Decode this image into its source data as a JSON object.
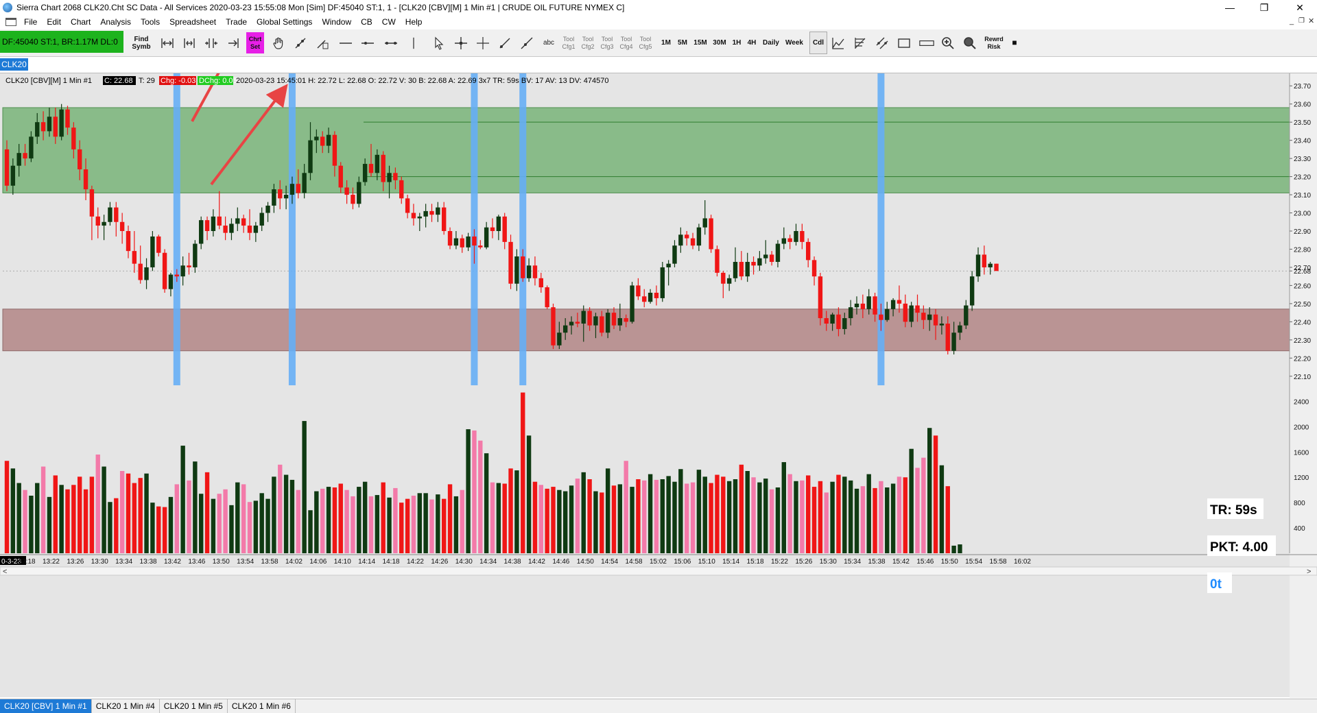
{
  "window": {
    "title": "Sierra Chart 2068 CLK20.Cht  SC Data - All Services 2020-03-23  15:55:08 Mon [Sim]  DF:45040  ST:1, 1 - [CLK20 [CBV][M]  1 Min  #1 | CRUDE OIL FUTURE NYMEX C]",
    "minimize": "—",
    "restore": "❐",
    "close": "✕"
  },
  "menu": [
    "File",
    "Edit",
    "Chart",
    "Analysis",
    "Tools",
    "Spreadsheet",
    "Trade",
    "Global Settings",
    "Window",
    "CB",
    "CW",
    "Help"
  ],
  "status_box": "DF:45040  ST:1,  BR:1.17M  DL:0",
  "toolbar": {
    "find_symbol": "Find Symb",
    "chart_settings": "Chrt Set",
    "text_tool": "abc",
    "tool_cfgs": [
      "Tool Cfg1",
      "Tool Cfg2",
      "Tool Cfg3",
      "Tool Cfg4",
      "Tool Cfg5"
    ],
    "timeframes": [
      "1M",
      "5M",
      "15M",
      "30M",
      "1H",
      "4H",
      "Daily",
      "Week"
    ],
    "candle": "Cdl",
    "reward_risk": "Rewrd Risk",
    "stop": "■"
  },
  "symbol_tab": "CLK20",
  "chart_header": {
    "symbol": "CLK20 [CBV][M]  1 Min  #1",
    "close": "C: 22.68",
    "trades": "T: 29",
    "change": "Chg: -0.03",
    "dchange": "DChg: 0.05",
    "details": "2020-03-23  15:45:01  H: 22.72  L: 22.68  O: 22.72  V: 30  B: 22.68  A: 22.69  3x7  TR: 59s  BV: 17  AV: 13  DV: 474570"
  },
  "overlay": {
    "tr": "TR: 59s",
    "pkt": "PKT: 4.00",
    "ot": "0t"
  },
  "colors": {
    "up": "#0f3a12",
    "down": "#f01616",
    "vol_up": "#0f3a12",
    "vol_down": "#f01616",
    "vol_down_light": "#f37aa9",
    "supply_zone": "#6fb06f",
    "demand_zone": "#b38686",
    "vline": "#66aef5",
    "arrow": "#e84444",
    "background": "#e5e5e5"
  },
  "chart_data": {
    "type": "candlestick",
    "price_axis_labels": [
      "23.70",
      "23.60",
      "23.50",
      "23.40",
      "23.30",
      "23.20",
      "23.10",
      "23.00",
      "22.90",
      "22.80",
      "22.70",
      "22.68",
      "22.60",
      "22.50",
      "22.40",
      "22.30",
      "22.20",
      "22.10"
    ],
    "price_ylim": [
      22.05,
      23.75
    ],
    "volume_axis_labels": [
      "2400",
      "2000",
      "1600",
      "1200",
      "800",
      "400"
    ],
    "volume_ylim": [
      0,
      2600
    ],
    "time_labels": [
      "0-3-23",
      "13:18",
      "13:22",
      "13:26",
      "13:30",
      "13:34",
      "13:38",
      "13:42",
      "13:46",
      "13:50",
      "13:54",
      "13:58",
      "14:02",
      "14:06",
      "14:10",
      "14:14",
      "14:18",
      "14:22",
      "14:26",
      "14:30",
      "14:34",
      "14:38",
      "14:42",
      "14:46",
      "14:50",
      "14:54",
      "14:58",
      "15:02",
      "15:06",
      "15:10",
      "15:14",
      "15:18",
      "15:22",
      "15:26",
      "15:30",
      "15:34",
      "15:38",
      "15:42",
      "15:46",
      "15:50",
      "15:54",
      "15:58",
      "16:02"
    ],
    "zones": [
      {
        "from": 23.11,
        "to": 23.58,
        "kind": "supply"
      },
      {
        "from": 22.24,
        "to": 22.47,
        "kind": "demand"
      }
    ],
    "zone_lines": [
      23.5,
      23.2
    ],
    "current_price_line": 22.68,
    "vertical_markers_bar_index": [
      28,
      47,
      77,
      85,
      144
    ],
    "candles": [
      [
        23.35,
        23.4,
        23.12,
        23.15
      ],
      [
        23.15,
        23.3,
        23.1,
        23.26
      ],
      [
        23.26,
        23.38,
        23.2,
        23.33
      ],
      [
        23.33,
        23.38,
        23.26,
        23.3
      ],
      [
        23.3,
        23.45,
        23.28,
        23.42
      ],
      [
        23.42,
        23.55,
        23.38,
        23.5
      ],
      [
        23.5,
        23.56,
        23.4,
        23.45
      ],
      [
        23.45,
        23.58,
        23.42,
        23.53
      ],
      [
        23.53,
        23.58,
        23.38,
        23.42
      ],
      [
        23.42,
        23.6,
        23.4,
        23.57
      ],
      [
        23.57,
        23.59,
        23.43,
        23.47
      ],
      [
        23.47,
        23.5,
        23.3,
        23.35
      ],
      [
        23.35,
        23.4,
        23.18,
        23.24
      ],
      [
        23.24,
        23.3,
        23.07,
        23.13
      ],
      [
        23.13,
        23.15,
        22.85,
        22.98
      ],
      [
        22.98,
        23.03,
        22.86,
        22.93
      ],
      [
        22.93,
        22.99,
        22.85,
        22.95
      ],
      [
        22.95,
        23.06,
        22.93,
        23.03
      ],
      [
        23.03,
        23.06,
        22.87,
        22.95
      ],
      [
        22.95,
        23.0,
        22.83,
        22.9
      ],
      [
        22.9,
        22.93,
        22.75,
        22.79
      ],
      [
        22.79,
        22.9,
        22.67,
        22.72
      ],
      [
        22.72,
        22.82,
        22.61,
        22.63
      ],
      [
        22.63,
        22.75,
        22.58,
        22.7
      ],
      [
        22.7,
        22.9,
        22.68,
        22.87
      ],
      [
        22.87,
        22.88,
        22.76,
        22.78
      ],
      [
        22.78,
        22.8,
        22.56,
        22.58
      ],
      [
        22.58,
        22.67,
        22.54,
        22.66
      ],
      [
        22.66,
        22.69,
        22.62,
        22.65
      ],
      [
        22.65,
        22.76,
        22.6,
        22.71
      ],
      [
        22.71,
        22.78,
        22.66,
        22.7
      ],
      [
        22.7,
        22.85,
        22.67,
        22.83
      ],
      [
        22.83,
        22.98,
        22.8,
        22.96
      ],
      [
        22.96,
        22.98,
        22.85,
        22.9
      ],
      [
        22.9,
        23.02,
        22.87,
        22.98
      ],
      [
        22.98,
        23.12,
        22.91,
        22.93
      ],
      [
        22.93,
        22.98,
        22.85,
        22.89
      ],
      [
        22.89,
        22.97,
        22.85,
        22.94
      ],
      [
        22.94,
        23.03,
        22.9,
        22.97
      ],
      [
        22.97,
        22.99,
        22.89,
        22.93
      ],
      [
        22.93,
        23.02,
        22.85,
        22.89
      ],
      [
        22.89,
        22.95,
        22.84,
        22.93
      ],
      [
        22.93,
        23.03,
        22.9,
        23.0
      ],
      [
        23.0,
        23.06,
        22.95,
        23.04
      ],
      [
        23.04,
        23.16,
        23.0,
        23.13
      ],
      [
        23.13,
        23.18,
        23.02,
        23.08
      ],
      [
        23.08,
        23.15,
        23.02,
        23.1
      ],
      [
        23.1,
        23.2,
        23.05,
        23.16
      ],
      [
        23.16,
        23.24,
        23.08,
        23.11
      ],
      [
        23.11,
        23.27,
        23.08,
        23.22
      ],
      [
        23.22,
        23.5,
        23.18,
        23.4
      ],
      [
        23.4,
        23.46,
        23.33,
        23.42
      ],
      [
        23.42,
        23.45,
        23.33,
        23.37
      ],
      [
        23.37,
        23.47,
        23.33,
        23.43
      ],
      [
        23.43,
        23.45,
        23.2,
        23.26
      ],
      [
        23.26,
        23.28,
        23.11,
        23.14
      ],
      [
        23.14,
        23.18,
        23.05,
        23.1
      ],
      [
        23.1,
        23.14,
        23.02,
        23.05
      ],
      [
        23.05,
        23.2,
        23.03,
        23.17
      ],
      [
        23.17,
        23.3,
        23.15,
        23.27
      ],
      [
        23.27,
        23.38,
        23.2,
        23.22
      ],
      [
        23.22,
        23.35,
        23.18,
        23.32
      ],
      [
        23.32,
        23.34,
        23.12,
        23.17
      ],
      [
        23.17,
        23.26,
        23.08,
        23.22
      ],
      [
        23.22,
        23.25,
        23.13,
        23.18
      ],
      [
        23.18,
        23.2,
        23.05,
        23.08
      ],
      [
        23.08,
        23.1,
        22.97,
        23.0
      ],
      [
        23.0,
        23.05,
        22.93,
        22.97
      ],
      [
        22.97,
        23.0,
        22.9,
        22.98
      ],
      [
        22.98,
        23.05,
        22.92,
        23.01
      ],
      [
        23.01,
        23.05,
        22.95,
        22.99
      ],
      [
        22.99,
        23.06,
        22.95,
        23.03
      ],
      [
        23.03,
        23.06,
        22.88,
        22.9
      ],
      [
        22.9,
        22.92,
        22.8,
        22.82
      ],
      [
        22.82,
        22.9,
        22.8,
        22.86
      ],
      [
        22.86,
        22.88,
        22.78,
        22.81
      ],
      [
        22.81,
        22.89,
        22.79,
        22.87
      ],
      [
        22.87,
        22.91,
        22.72,
        22.82
      ],
      [
        22.82,
        22.85,
        22.8,
        22.81
      ],
      [
        22.81,
        22.95,
        22.8,
        22.92
      ],
      [
        22.92,
        22.97,
        22.86,
        22.9
      ],
      [
        22.9,
        22.99,
        22.85,
        22.98
      ],
      [
        22.98,
        23.0,
        22.8,
        22.84
      ],
      [
        22.84,
        22.88,
        22.58,
        22.61
      ],
      [
        22.61,
        22.8,
        22.57,
        22.76
      ],
      [
        22.76,
        22.8,
        22.62,
        22.64
      ],
      [
        22.64,
        22.75,
        22.62,
        22.71
      ],
      [
        22.71,
        22.76,
        22.6,
        22.64
      ],
      [
        22.64,
        22.67,
        22.56,
        22.59
      ],
      [
        22.59,
        22.6,
        22.47,
        22.48
      ],
      [
        22.48,
        22.5,
        22.25,
        22.27
      ],
      [
        22.27,
        22.4,
        22.25,
        22.34
      ],
      [
        22.34,
        22.42,
        22.3,
        22.38
      ],
      [
        22.38,
        22.43,
        22.33,
        22.4
      ],
      [
        22.4,
        22.45,
        22.37,
        22.39
      ],
      [
        22.39,
        22.49,
        22.29,
        22.46
      ],
      [
        22.46,
        22.48,
        22.35,
        22.38
      ],
      [
        22.38,
        22.45,
        22.31,
        22.43
      ],
      [
        22.43,
        22.46,
        22.32,
        22.34
      ],
      [
        22.34,
        22.47,
        22.31,
        22.45
      ],
      [
        22.45,
        22.48,
        22.36,
        22.38
      ],
      [
        22.38,
        22.5,
        22.35,
        22.42
      ],
      [
        22.42,
        22.44,
        22.37,
        22.4
      ],
      [
        22.4,
        22.62,
        22.39,
        22.6
      ],
      [
        22.6,
        22.64,
        22.52,
        22.54
      ],
      [
        22.54,
        22.58,
        22.48,
        22.51
      ],
      [
        22.51,
        22.58,
        22.5,
        22.56
      ],
      [
        22.56,
        22.6,
        22.49,
        22.53
      ],
      [
        22.53,
        22.73,
        22.51,
        22.7
      ],
      [
        22.7,
        22.74,
        22.6,
        22.72
      ],
      [
        22.72,
        22.85,
        22.7,
        22.82
      ],
      [
        22.82,
        22.92,
        22.78,
        22.88
      ],
      [
        22.88,
        22.9,
        22.82,
        22.86
      ],
      [
        22.86,
        22.89,
        22.8,
        22.82
      ],
      [
        22.82,
        22.94,
        22.79,
        22.92
      ],
      [
        22.92,
        23.07,
        22.88,
        22.97
      ],
      [
        22.97,
        22.99,
        22.78,
        22.8
      ],
      [
        22.8,
        22.82,
        22.65,
        22.67
      ],
      [
        22.67,
        22.68,
        22.53,
        22.61
      ],
      [
        22.61,
        22.66,
        22.57,
        22.64
      ],
      [
        22.64,
        22.81,
        22.62,
        22.73
      ],
      [
        22.73,
        22.79,
        22.63,
        22.65
      ],
      [
        22.65,
        22.78,
        22.62,
        22.73
      ],
      [
        22.73,
        22.76,
        22.66,
        22.71
      ],
      [
        22.71,
        22.79,
        22.68,
        22.75
      ],
      [
        22.75,
        22.85,
        22.72,
        22.77
      ],
      [
        22.77,
        22.79,
        22.71,
        22.73
      ],
      [
        22.73,
        22.85,
        22.7,
        22.83
      ],
      [
        22.83,
        22.92,
        22.8,
        22.86
      ],
      [
        22.86,
        22.88,
        22.8,
        22.84
      ],
      [
        22.84,
        22.94,
        22.82,
        22.9
      ],
      [
        22.9,
        22.94,
        22.8,
        22.84
      ],
      [
        22.84,
        22.86,
        22.7,
        22.74
      ],
      [
        22.74,
        22.76,
        22.6,
        22.65
      ],
      [
        22.65,
        22.67,
        22.38,
        22.42
      ],
      [
        22.42,
        22.46,
        22.35,
        22.39
      ],
      [
        22.39,
        22.45,
        22.35,
        22.44
      ],
      [
        22.44,
        22.48,
        22.32,
        22.36
      ],
      [
        22.36,
        22.45,
        22.33,
        22.42
      ],
      [
        22.42,
        22.52,
        22.38,
        22.48
      ],
      [
        22.48,
        22.54,
        22.44,
        22.5
      ],
      [
        22.5,
        22.55,
        22.42,
        22.47
      ],
      [
        22.47,
        22.58,
        22.44,
        22.54
      ],
      [
        22.54,
        22.56,
        22.4,
        22.44
      ],
      [
        22.44,
        22.5,
        22.35,
        22.41
      ],
      [
        22.41,
        22.51,
        22.4,
        22.47
      ],
      [
        22.47,
        22.53,
        22.43,
        22.52
      ],
      [
        22.52,
        22.6,
        22.45,
        22.5
      ],
      [
        22.5,
        22.55,
        22.37,
        22.4
      ],
      [
        22.4,
        22.51,
        22.37,
        22.49
      ],
      [
        22.49,
        22.55,
        22.4,
        22.45
      ],
      [
        22.45,
        22.49,
        22.36,
        22.41
      ],
      [
        22.41,
        22.48,
        22.35,
        22.44
      ],
      [
        22.44,
        22.47,
        22.3,
        22.38
      ],
      [
        22.38,
        22.43,
        22.33,
        22.39
      ],
      [
        22.39,
        22.43,
        22.22,
        22.24
      ],
      [
        22.24,
        22.4,
        22.22,
        22.34
      ],
      [
        22.34,
        22.4,
        22.3,
        22.38
      ],
      [
        22.38,
        22.52,
        22.36,
        22.49
      ],
      [
        22.49,
        22.68,
        22.46,
        22.65
      ],
      [
        22.65,
        22.81,
        22.62,
        22.77
      ],
      [
        22.77,
        22.82,
        22.66,
        22.7
      ],
      [
        22.7,
        22.73,
        22.66,
        22.72
      ],
      [
        22.72,
        22.72,
        22.68,
        22.68
      ]
    ],
    "volumes": [
      1460,
      1340,
      1110,
      1000,
      910,
      1110,
      1370,
      890,
      1230,
      1080,
      1010,
      1080,
      1210,
      1010,
      1210,
      1560,
      1370,
      810,
      870,
      1300,
      1260,
      1110,
      1190,
      1260,
      800,
      740,
      730,
      890,
      1090,
      1700,
      1150,
      1450,
      940,
      1280,
      860,
      940,
      1010,
      760,
      1120,
      1090,
      810,
      830,
      950,
      860,
      1210,
      1400,
      1240,
      1160,
      1000,
      2090,
      680,
      980,
      1020,
      1050,
      1040,
      1100,
      1000,
      900,
      1050,
      1130,
      900,
      920,
      1120,
      880,
      1030,
      800,
      860,
      910,
      950,
      950,
      850,
      930,
      860,
      1090,
      900,
      1000,
      1960,
      1940,
      1780,
      1580,
      1120,
      1110,
      1100,
      1340,
      1310,
      2540,
      1860,
      1130,
      1080,
      1020,
      1050,
      1000,
      980,
      1070,
      1180,
      1280,
      1170,
      980,
      960,
      1340,
      1070,
      1090,
      1460,
      1050,
      1170,
      1150,
      1250,
      1160,
      1170,
      1220,
      1130,
      1330,
      1100,
      1120,
      1320,
      1210,
      1110,
      1240,
      1210,
      1140,
      1170,
      1400,
      1300,
      1200,
      1120,
      1180,
      1010,
      1040,
      1440,
      1250,
      1140,
      1150,
      1230,
      1050,
      1140,
      960,
      1130,
      1240,
      1210,
      1150,
      1020,
      1060,
      1250,
      1030,
      1140,
      1040,
      1100,
      1210,
      1200,
      1650,
      1350,
      1510,
      1980,
      1860,
      1390,
      1060,
      120,
      140
    ]
  }
}
